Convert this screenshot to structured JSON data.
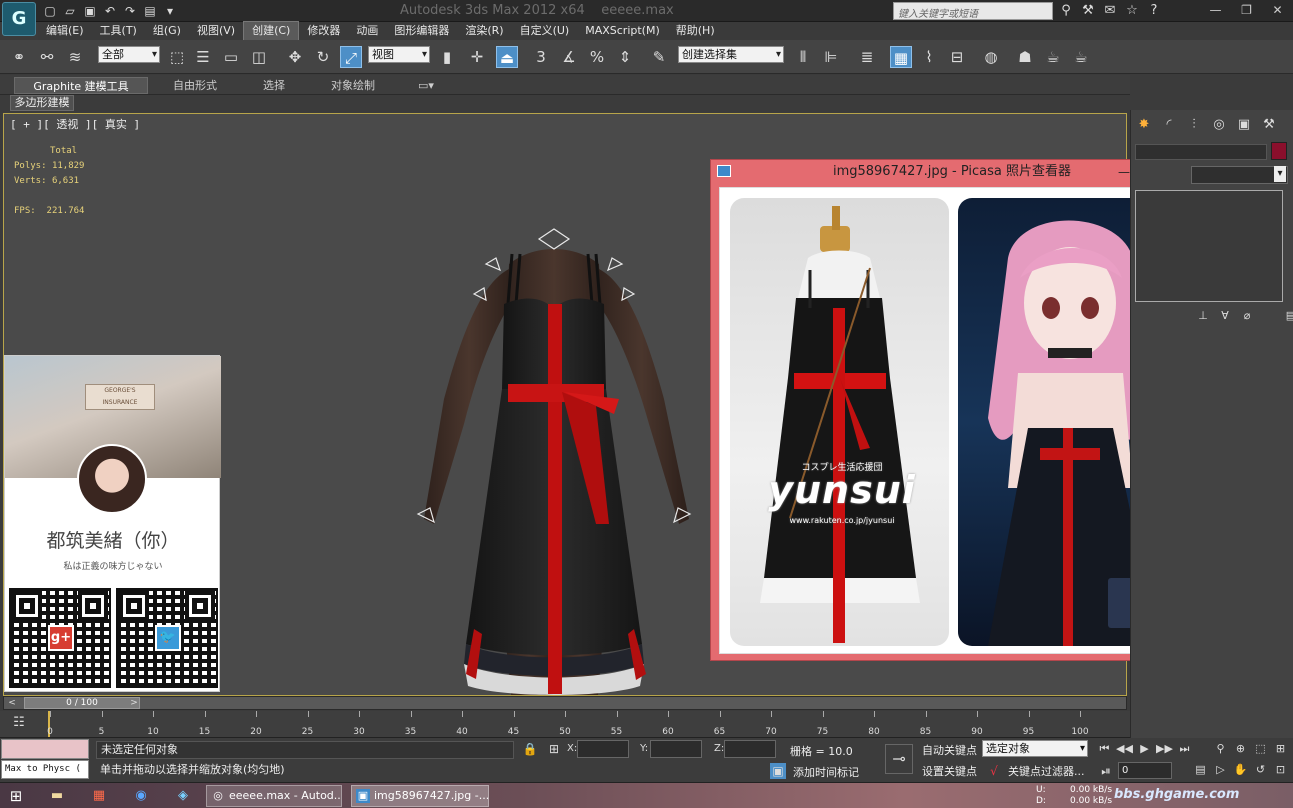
{
  "title": {
    "app": "Autodesk 3ds Max  2012 x64",
    "file": "eeeee.max",
    "search_placeholder": "键入关键字或短语"
  },
  "menu": [
    "编辑(E)",
    "工具(T)",
    "组(G)",
    "视图(V)",
    "创建(C)",
    "修改器",
    "动画",
    "图形编辑器",
    "渲染(R)",
    "自定义(U)",
    "MAXScript(M)",
    "帮助(H)"
  ],
  "menu_active_index": 4,
  "toolbar": {
    "filter_value": "全部",
    "refcoord_value": "视图",
    "selection_set_value": "创建选择集",
    "snap_labels": [
      "3",
      "%"
    ]
  },
  "ribbon": {
    "tabs": [
      "Graphite 建模工具",
      "自由形式",
      "选择",
      "对象绘制"
    ],
    "subtab": "多边形建模"
  },
  "viewport": {
    "label": "[ + ][ 透视 ][ 真实 ]",
    "stats_title": "Total",
    "polys_label": "Polys:",
    "polys_value": "11,829",
    "verts_label": "Verts:",
    "verts_value": "6,631",
    "fps_label": "FPS:",
    "fps_value": "221.764"
  },
  "card": {
    "name": "都筑美緒（你）",
    "motto": "私は正義の味方じゃない",
    "sign": "GEORGE'S INSURANCE",
    "qr_badges": [
      "g+",
      "🐦"
    ]
  },
  "picasa": {
    "title": "img58967427.jpg - Picasa 照片查看器",
    "watermark": "yunsui",
    "watermark_small": "コスプレ生活応援団",
    "watermark_url": "www.rakuten.co.jp/jyunsui"
  },
  "timeslider": {
    "value": "0 / 100"
  },
  "ruler_ticks": [
    "0",
    "5",
    "10",
    "15",
    "20",
    "25",
    "30",
    "35",
    "40",
    "45",
    "50",
    "55",
    "60",
    "65",
    "70",
    "75",
    "80",
    "85",
    "90",
    "95",
    "100"
  ],
  "status": {
    "maxscript": "Max to Physc (",
    "line1": "未选定任何对象",
    "line2": "单击并拖动以选择并缩放对象(均匀地)",
    "x_label": "X:",
    "y_label": "Y:",
    "z_label": "Z:",
    "grid": "栅格 = 10.0",
    "add_time_tag": "添加时间标记",
    "auto_key": "自动关键点",
    "set_key": "设置关键点",
    "selected_dropdown": "选定对象",
    "key_filters": "关键点过滤器...",
    "current_frame": "0"
  },
  "taskbar": {
    "tasks": [
      "eeeee.max - Autod...",
      "img58967427.jpg -..."
    ],
    "net_lines": [
      "U:",
      "D:"
    ],
    "net_values": [
      "0.00 kB/s",
      "0.00 kB/s"
    ],
    "site": "bbs.ghgame.com"
  }
}
